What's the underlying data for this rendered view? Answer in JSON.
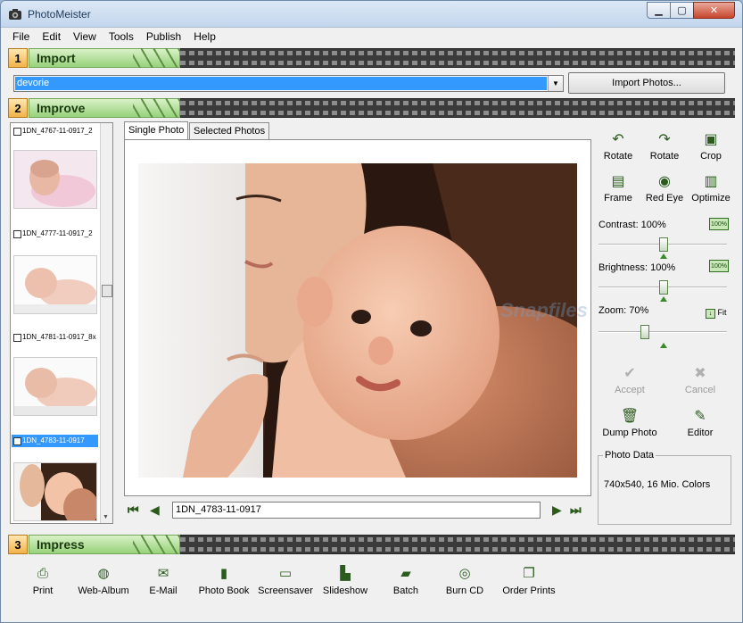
{
  "window": {
    "title": "PhotoMeister"
  },
  "menu": [
    "File",
    "Edit",
    "View",
    "Tools",
    "Publish",
    "Help"
  ],
  "sections": {
    "import": {
      "num": "1",
      "label": "Import"
    },
    "improve": {
      "num": "2",
      "label": "Improve"
    },
    "impress": {
      "num": "3",
      "label": "Impress"
    }
  },
  "import": {
    "folder_value": "devorie",
    "import_button": "Import Photos..."
  },
  "thumbnails": [
    {
      "caption": "1DN_4767-11-0917_2",
      "selected": false
    },
    {
      "caption": "1DN_4777-11-0917_2",
      "selected": false
    },
    {
      "caption": "1DN_4781-11-0917_8x",
      "selected": false
    },
    {
      "caption": "1DN_4783-11-0917",
      "selected": true
    }
  ],
  "tabs": {
    "single": "Single Photo",
    "selected": "Selected Photos"
  },
  "nav": {
    "filename": "1DN_4783-11-0917"
  },
  "tools": {
    "rotate_left": "Rotate",
    "rotate_right": "Rotate",
    "crop": "Crop",
    "frame": "Frame",
    "red_eye": "Red Eye",
    "optimize": "Optimize",
    "contrast": {
      "label": "Contrast: 100%",
      "value_pct": 100
    },
    "brightness": {
      "label": "Brightness: 100%",
      "value_pct": 100
    },
    "zoom": {
      "label": "Zoom: 70%",
      "value_pct": 70,
      "fit": "Fit"
    },
    "pct_badge": "100%",
    "accept": "Accept",
    "cancel": "Cancel",
    "dump_photo": "Dump Photo",
    "editor": "Editor"
  },
  "photo_data": {
    "title": "Photo Data",
    "value": "740x540, 16 Mio. Colors"
  },
  "impress": [
    "Print",
    "Web-Album",
    "E-Mail",
    "Photo Book",
    "Screensaver",
    "Slideshow",
    "Batch",
    "Burn CD",
    "Order Prints"
  ],
  "watermark": "Snapfiles",
  "colors": {
    "accent": "#3399ff",
    "section_green": "#97d27a",
    "section_orange": "#f2b24a"
  }
}
